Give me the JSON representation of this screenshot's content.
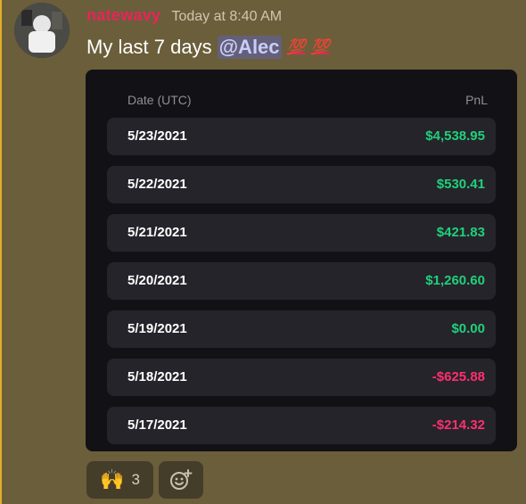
{
  "message": {
    "username": "natewavy",
    "timestamp": "Today at 8:40 AM",
    "text": "My last 7 days",
    "mention": "@Alec",
    "emoji_1": "💯",
    "emoji_2": "💯"
  },
  "table": {
    "header": {
      "date": "Date (UTC)",
      "pnl": "PnL"
    },
    "rows": [
      {
        "date": "5/23/2021",
        "pnl": "$4,538.95",
        "sign": "pos"
      },
      {
        "date": "5/22/2021",
        "pnl": "$530.41",
        "sign": "pos"
      },
      {
        "date": "5/21/2021",
        "pnl": "$421.83",
        "sign": "pos"
      },
      {
        "date": "5/20/2021",
        "pnl": "$1,260.60",
        "sign": "pos"
      },
      {
        "date": "5/19/2021",
        "pnl": "$0.00",
        "sign": "zero"
      },
      {
        "date": "5/18/2021",
        "pnl": "-$625.88",
        "sign": "neg"
      },
      {
        "date": "5/17/2021",
        "pnl": "-$214.32",
        "sign": "neg"
      }
    ]
  },
  "reactions": {
    "raised_hands": {
      "emoji": "🙌",
      "count": "3"
    },
    "add_reaction_icon": "smiley-add-icon"
  },
  "colors": {
    "positive": "#1fd17a",
    "negative": "#ff2f6e",
    "username": "#e8245a",
    "background": "#6b5e3a"
  }
}
